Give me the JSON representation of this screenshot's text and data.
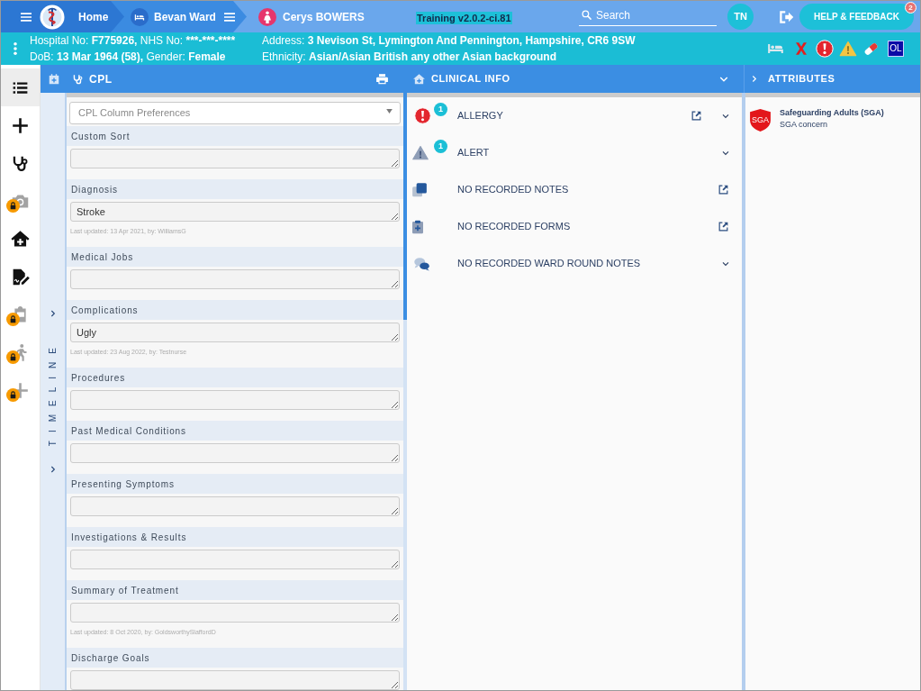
{
  "top_bar": {
    "breadcrumbs": [
      {
        "kind": "home",
        "label": "Home",
        "menu": true
      },
      {
        "kind": "ward",
        "label": "Bevan Ward",
        "menu": true
      },
      {
        "kind": "patient",
        "label": "Cerys BOWERS",
        "menu": false
      }
    ],
    "environment": "Training v2.0.2-ci.81",
    "search": {
      "placeholder": "Search"
    },
    "user_initials": "TN",
    "help_button": {
      "label": "HELP & FEEDBACK",
      "badge": "2"
    }
  },
  "patient_bar": {
    "left_lines": [
      [
        {
          "label": "Hospital No:",
          "value": "F775926,"
        },
        {
          "label": "NHS No:",
          "value": "***-***-****"
        }
      ],
      [
        {
          "label": "DoB:",
          "value": "13 Mar 1964 (58),"
        },
        {
          "label": "Gender:",
          "value": "Female"
        }
      ]
    ],
    "right_lines": [
      [
        {
          "label": "Address:",
          "value": "3 Nevison St, Lymington And Pennington, Hampshire, CR6 9SW"
        }
      ],
      [
        {
          "label": "Ethnicity:",
          "value": "Asian/Asian British any other Asian background"
        }
      ]
    ],
    "indicators": [
      {
        "kind": "bed"
      },
      {
        "kind": "cross"
      },
      {
        "kind": "allergy"
      },
      {
        "kind": "alert"
      },
      {
        "kind": "medication"
      },
      {
        "kind": "label",
        "label": "OL"
      }
    ]
  },
  "sidebar": {
    "items": [
      {
        "kind": "list",
        "selected": true,
        "locked": false
      },
      {
        "kind": "add",
        "selected": false,
        "locked": false
      },
      {
        "kind": "stethoscope",
        "selected": false,
        "locked": false
      },
      {
        "kind": "camera",
        "selected": false,
        "locked": true
      },
      {
        "kind": "home_care",
        "selected": false,
        "locked": false
      },
      {
        "kind": "signed_document",
        "selected": false,
        "locked": false
      },
      {
        "kind": "clipboard_chat",
        "selected": false,
        "locked": true
      },
      {
        "kind": "walking",
        "selected": false,
        "locked": true
      },
      {
        "kind": "add",
        "selected": false,
        "locked": true
      }
    ]
  },
  "timeline": {
    "label": "TIMELINE"
  },
  "cpl": {
    "title": "CPL",
    "preferences": {
      "placeholder": "CPL Column Preferences"
    },
    "sections": [
      {
        "label": "Custom Sort"
      },
      {
        "label": "Diagnosis",
        "value": "Stroke",
        "last_updated": "Last updated: 13 Apr 2021, by: WilliamsG"
      },
      {
        "label": "Medical Jobs"
      },
      {
        "label": "Complications",
        "value": "Ugly",
        "last_updated": "Last updated: 23 Aug 2022, by: Testnurse"
      },
      {
        "label": "Procedures"
      },
      {
        "label": "Past Medical Conditions"
      },
      {
        "label": "Presenting Symptoms"
      },
      {
        "label": "Investigations & Results"
      },
      {
        "label": "Summary of Treatment",
        "last_updated": "Last updated: 8 Oct 2020, by: GoldsworthySlaffordD"
      },
      {
        "label": "Discharge Goals"
      }
    ]
  },
  "clinical_info": {
    "title": "CLINICAL INFO",
    "rows": [
      {
        "kind": "allergy",
        "label": "ALLERGY",
        "count": "1",
        "external_link": true,
        "expandable": true
      },
      {
        "kind": "alert",
        "label": "ALERT",
        "count": "1",
        "external_link": false,
        "expandable": true
      },
      {
        "kind": "notes",
        "label": "NO RECORDED NOTES",
        "external_link": true,
        "expandable": false
      },
      {
        "kind": "forms",
        "label": "NO RECORDED FORMS",
        "external_link": true,
        "expandable": false
      },
      {
        "kind": "ward_round",
        "label": "NO RECORDED WARD ROUND NOTES",
        "external_link": false,
        "expandable": true
      }
    ]
  },
  "attributes": {
    "title": "ATTRIBUTES",
    "items": [
      {
        "badge": "SGA",
        "title": "Safeguarding Adults (SGA)",
        "subtitle": "SGA concern"
      }
    ]
  }
}
